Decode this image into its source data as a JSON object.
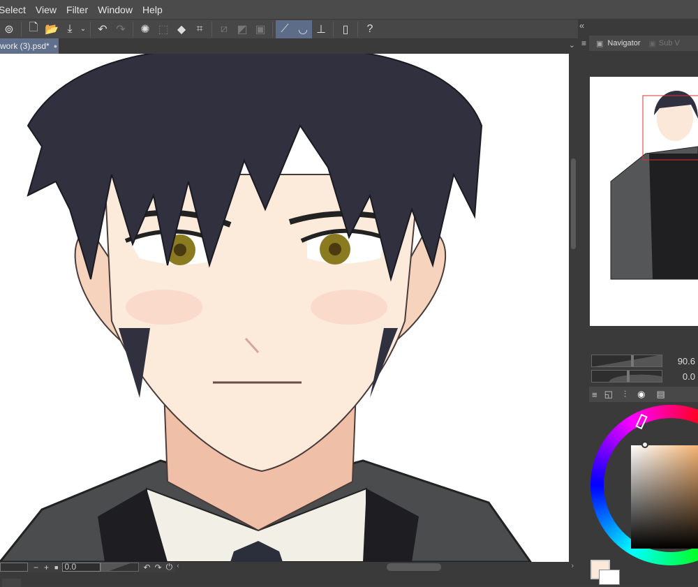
{
  "menu": [
    "Select",
    "View",
    "Filter",
    "Window",
    "Help"
  ],
  "document": {
    "tab_title": "work (3).psd*"
  },
  "navigator": {
    "tab_label": "Navigator",
    "sub_tab_label": "Sub V"
  },
  "sliders": {
    "zoom_value": "90.6",
    "rotate_value": "0.0"
  },
  "status": {
    "angle_value": "0.0"
  },
  "colors": {
    "main_color": "#fbe9db",
    "sub_color": "#ffffff",
    "accent": "#5d6d89"
  }
}
